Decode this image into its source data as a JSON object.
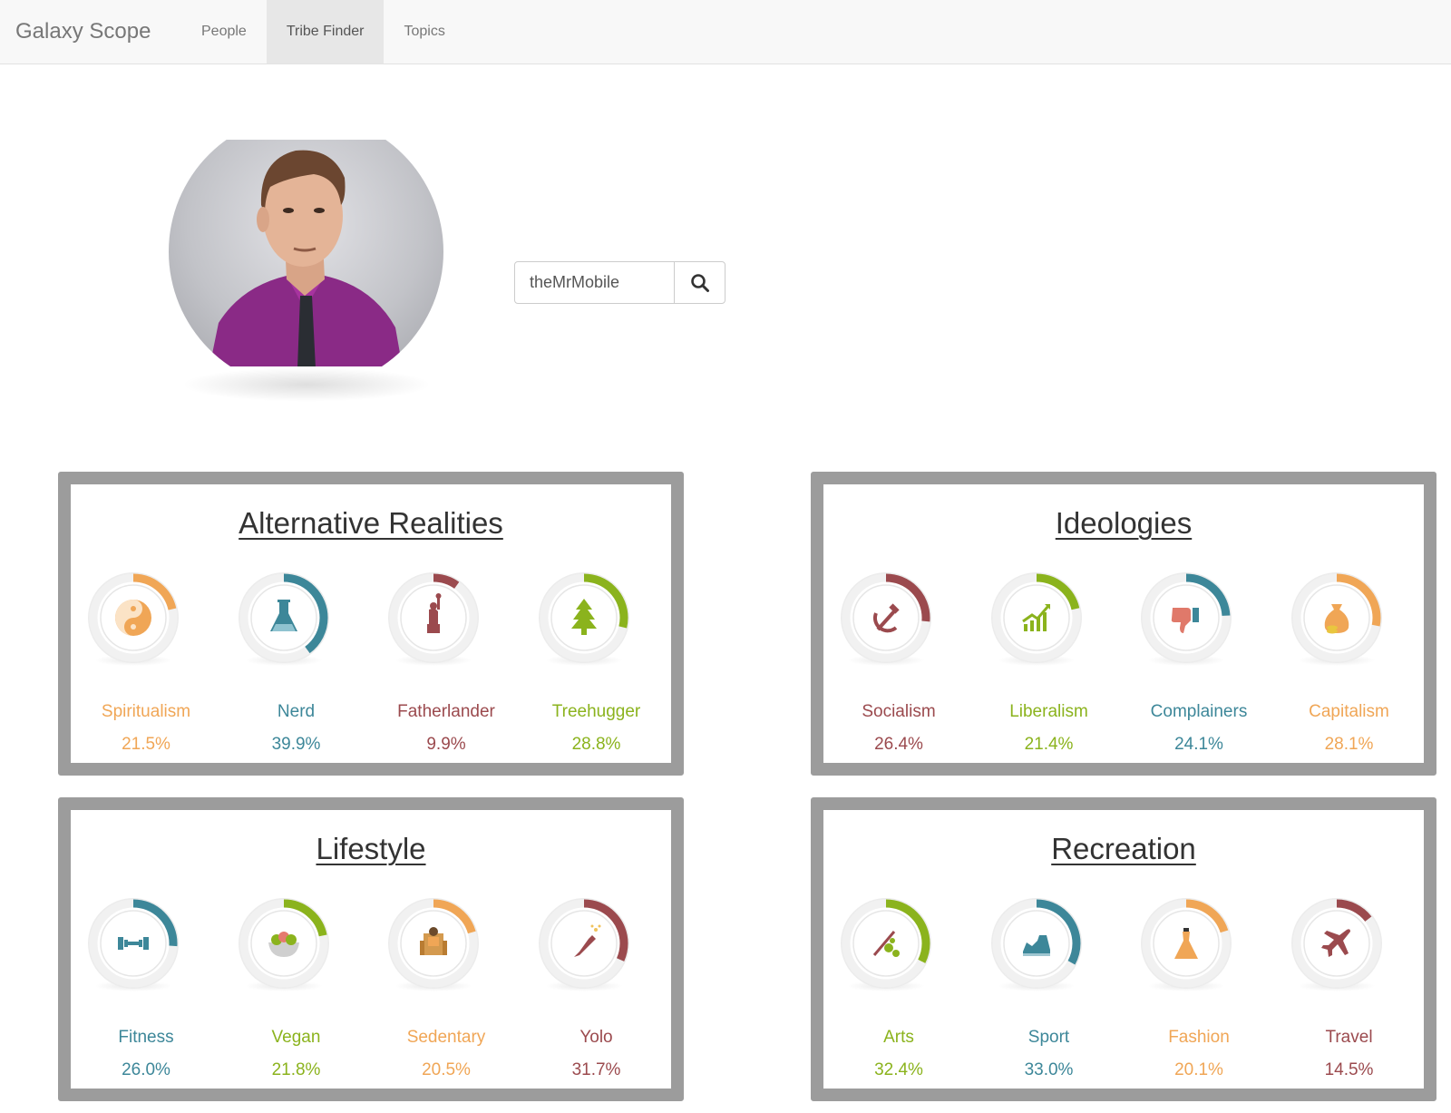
{
  "navbar": {
    "brand": "Galaxy Scope",
    "items": [
      {
        "label": "People",
        "active": false
      },
      {
        "label": "Tribe Finder",
        "active": true
      },
      {
        "label": "Topics",
        "active": false
      }
    ]
  },
  "search": {
    "value": "theMrMobile",
    "icon": "search-icon"
  },
  "colors": {
    "orange": "#f0a656",
    "teal": "#3d8799",
    "maroon": "#9b4a4e",
    "green": "#8bb31d"
  },
  "panels": [
    {
      "title": "Alternative Realities",
      "tribes": [
        {
          "name": "Spiritualism",
          "percent": "21.5%",
          "value": 21.5,
          "color": "#f0a656",
          "icon": "yin-yang-icon"
        },
        {
          "name": "Nerd",
          "percent": "39.9%",
          "value": 39.9,
          "color": "#3d8799",
          "icon": "flask-icon"
        },
        {
          "name": "Fatherlander",
          "percent": "9.9%",
          "value": 9.9,
          "color": "#9b4a4e",
          "icon": "statue-of-liberty-icon"
        },
        {
          "name": "Treehugger",
          "percent": "28.8%",
          "value": 28.8,
          "color": "#8bb31d",
          "icon": "tree-icon"
        }
      ]
    },
    {
      "title": "Ideologies",
      "tribes": [
        {
          "name": "Socialism",
          "percent": "26.4%",
          "value": 26.4,
          "color": "#9b4a4e",
          "icon": "hammer-sickle-icon"
        },
        {
          "name": "Liberalism",
          "percent": "21.4%",
          "value": 21.4,
          "color": "#8bb31d",
          "icon": "growth-chart-icon"
        },
        {
          "name": "Complainers",
          "percent": "24.1%",
          "value": 24.1,
          "color": "#3d8799",
          "icon": "thumbs-down-icon"
        },
        {
          "name": "Capitalism",
          "percent": "28.1%",
          "value": 28.1,
          "color": "#f0a656",
          "icon": "money-bag-icon"
        }
      ]
    },
    {
      "title": "Lifestyle",
      "tribes": [
        {
          "name": "Fitness",
          "percent": "26.0%",
          "value": 26.0,
          "color": "#3d8799",
          "icon": "dumbbell-icon"
        },
        {
          "name": "Vegan",
          "percent": "21.8%",
          "value": 21.8,
          "color": "#8bb31d",
          "icon": "salad-bowl-icon"
        },
        {
          "name": "Sedentary",
          "percent": "20.5%",
          "value": 20.5,
          "color": "#f0a656",
          "icon": "armchair-person-icon"
        },
        {
          "name": "Yolo",
          "percent": "31.7%",
          "value": 31.7,
          "color": "#9b4a4e",
          "icon": "champagne-icon"
        }
      ]
    },
    {
      "title": "Recreation",
      "tribes": [
        {
          "name": "Arts",
          "percent": "32.4%",
          "value": 32.4,
          "color": "#8bb31d",
          "icon": "palette-icon"
        },
        {
          "name": "Sport",
          "percent": "33.0%",
          "value": 33.0,
          "color": "#3d8799",
          "icon": "sneaker-icon"
        },
        {
          "name": "Fashion",
          "percent": "20.1%",
          "value": 20.1,
          "color": "#f0a656",
          "icon": "dress-icon"
        },
        {
          "name": "Travel",
          "percent": "14.5%",
          "value": 14.5,
          "color": "#9b4a4e",
          "icon": "airplane-icon"
        }
      ]
    }
  ]
}
